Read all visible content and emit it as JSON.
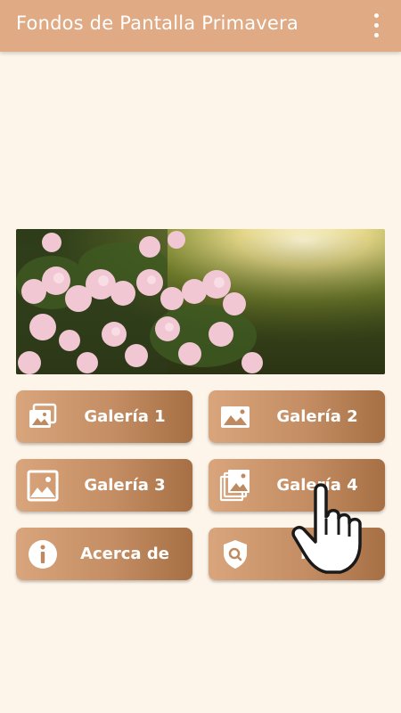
{
  "appbar": {
    "title": "Fondos de Pantalla Primavera",
    "menu_icon": "more-vert-icon",
    "color": "#dfaa84"
  },
  "banner": {
    "image": "spring-flowers-photo"
  },
  "buttons": [
    {
      "label": "Galería 1",
      "icon": "gallery-stack-icon"
    },
    {
      "label": "Galería 2",
      "icon": "image-icon"
    },
    {
      "label": "Galería 3",
      "icon": "photo-icon"
    },
    {
      "label": "Galería 4",
      "icon": "gallery-stack-icon"
    },
    {
      "label": "Acerca de",
      "icon": "info-icon"
    },
    {
      "label": "Poli",
      "icon": "shield-search-icon"
    }
  ],
  "colors": {
    "background": "#fdf5ea",
    "button_start": "#d9a57c",
    "button_end": "#a66f44"
  }
}
